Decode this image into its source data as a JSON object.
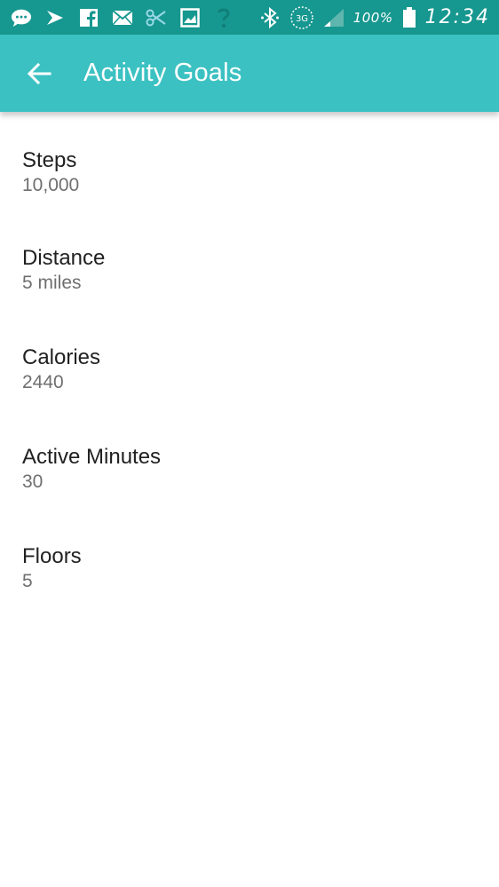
{
  "status_bar": {
    "icons_left": [
      "message-icon",
      "sprint-icon",
      "facebook-icon",
      "mail-icon",
      "scissors-icon",
      "gallery-icon",
      "question-icon"
    ],
    "icons_right": [
      "bluetooth-icon",
      "3g-icon",
      "signal-icon"
    ],
    "network_label": "3G",
    "battery_text": "100%",
    "time": "12:34"
  },
  "app_bar": {
    "title": "Activity Goals",
    "back_icon": "back-arrow-icon",
    "color": "#3cc1c2"
  },
  "goals": [
    {
      "label": "Steps",
      "value": "10,000"
    },
    {
      "label": "Distance",
      "value": "5 miles"
    },
    {
      "label": "Calories",
      "value": "2440"
    },
    {
      "label": "Active Minutes",
      "value": "30"
    },
    {
      "label": "Floors",
      "value": "5"
    }
  ],
  "colors": {
    "status_bar": "#16978f",
    "app_bar": "#3cc1c2",
    "label_text": "#212121",
    "value_text": "#6f6f6f"
  }
}
